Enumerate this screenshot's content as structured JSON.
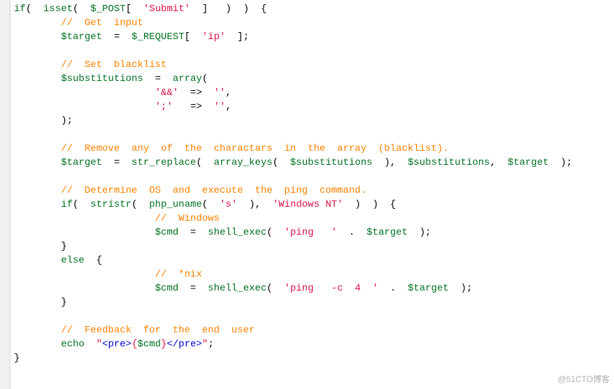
{
  "lines": [
    {
      "t": "l1",
      "segs": [
        {
          "cls": "kw",
          "txt": "if"
        },
        {
          "cls": "punc",
          "txt": "(  "
        },
        {
          "cls": "kw",
          "txt": "isset"
        },
        {
          "cls": "punc",
          "txt": "(  "
        },
        {
          "cls": "var",
          "txt": "$_POST"
        },
        {
          "cls": "punc",
          "txt": "[  "
        },
        {
          "cls": "str",
          "txt": "'Submit'"
        },
        {
          "cls": "punc",
          "txt": "  ]   )  )  {"
        }
      ]
    },
    {
      "t": "l2",
      "indent": 1,
      "segs": [
        {
          "cls": "cmt",
          "txt": "//  Get  input"
        }
      ]
    },
    {
      "t": "l3",
      "indent": 1,
      "segs": [
        {
          "cls": "var",
          "txt": "$target"
        },
        {
          "cls": "punc",
          "txt": "  =  "
        },
        {
          "cls": "var",
          "txt": "$_REQUEST"
        },
        {
          "cls": "punc",
          "txt": "[  "
        },
        {
          "cls": "str",
          "txt": "'ip'"
        },
        {
          "cls": "punc",
          "txt": "  ];"
        }
      ]
    },
    {
      "t": "blank1",
      "segs": []
    },
    {
      "t": "l4",
      "indent": 1,
      "segs": [
        {
          "cls": "cmt",
          "txt": "//  Set  blacklist"
        }
      ]
    },
    {
      "t": "l5",
      "indent": 1,
      "segs": [
        {
          "cls": "var",
          "txt": "$substitutions"
        },
        {
          "cls": "punc",
          "txt": "  =  "
        },
        {
          "cls": "kw",
          "txt": "array"
        },
        {
          "cls": "punc",
          "txt": "("
        }
      ]
    },
    {
      "t": "l6",
      "indent": 3,
      "segs": [
        {
          "cls": "str",
          "txt": "'&&'"
        },
        {
          "cls": "punc",
          "txt": "  =>  "
        },
        {
          "cls": "str",
          "txt": "''"
        },
        {
          "cls": "punc",
          "txt": ","
        }
      ]
    },
    {
      "t": "l7",
      "indent": 3,
      "segs": [
        {
          "cls": "str",
          "txt": "';'"
        },
        {
          "cls": "punc",
          "txt": "   =>  "
        },
        {
          "cls": "str",
          "txt": "''"
        },
        {
          "cls": "punc",
          "txt": ","
        }
      ]
    },
    {
      "t": "l8",
      "indent": 1,
      "segs": [
        {
          "cls": "punc",
          "txt": ");"
        }
      ]
    },
    {
      "t": "blank2",
      "segs": []
    },
    {
      "t": "l9",
      "indent": 1,
      "segs": [
        {
          "cls": "cmt",
          "txt": "//  Remove  any  of  the  charactars  in  the  array  (blacklist)."
        }
      ]
    },
    {
      "t": "l10",
      "indent": 1,
      "segs": [
        {
          "cls": "var",
          "txt": "$target"
        },
        {
          "cls": "punc",
          "txt": "  =  "
        },
        {
          "cls": "kw",
          "txt": "str_replace"
        },
        {
          "cls": "punc",
          "txt": "(  "
        },
        {
          "cls": "kw",
          "txt": "array_keys"
        },
        {
          "cls": "punc",
          "txt": "(  "
        },
        {
          "cls": "var",
          "txt": "$substitutions"
        },
        {
          "cls": "punc",
          "txt": "  ),  "
        },
        {
          "cls": "var",
          "txt": "$substitutions"
        },
        {
          "cls": "punc",
          "txt": ",  "
        },
        {
          "cls": "var",
          "txt": "$target"
        },
        {
          "cls": "punc",
          "txt": "  );"
        }
      ]
    },
    {
      "t": "blank3",
      "segs": []
    },
    {
      "t": "l11",
      "indent": 1,
      "segs": [
        {
          "cls": "cmt",
          "txt": "//  Determine  OS  and  execute  the  ping  command."
        }
      ]
    },
    {
      "t": "l12",
      "indent": 1,
      "segs": [
        {
          "cls": "kw",
          "txt": "if"
        },
        {
          "cls": "punc",
          "txt": "(  "
        },
        {
          "cls": "kw",
          "txt": "stristr"
        },
        {
          "cls": "punc",
          "txt": "(  "
        },
        {
          "cls": "kw",
          "txt": "php_uname"
        },
        {
          "cls": "punc",
          "txt": "(  "
        },
        {
          "cls": "str",
          "txt": "'s'"
        },
        {
          "cls": "punc",
          "txt": "  ),  "
        },
        {
          "cls": "str",
          "txt": "'Windows NT'"
        },
        {
          "cls": "punc",
          "txt": "  )  )  {"
        }
      ]
    },
    {
      "t": "l13",
      "indent": 3,
      "segs": [
        {
          "cls": "cmt",
          "txt": "//  Windows"
        }
      ]
    },
    {
      "t": "l14",
      "indent": 3,
      "segs": [
        {
          "cls": "var",
          "txt": "$cmd"
        },
        {
          "cls": "punc",
          "txt": "  =  "
        },
        {
          "cls": "kw",
          "txt": "shell_exec"
        },
        {
          "cls": "punc",
          "txt": "(  "
        },
        {
          "cls": "str",
          "txt": "'ping   '"
        },
        {
          "cls": "punc",
          "txt": "  .  "
        },
        {
          "cls": "var",
          "txt": "$target"
        },
        {
          "cls": "punc",
          "txt": "  );"
        }
      ]
    },
    {
      "t": "l15",
      "indent": 1,
      "segs": [
        {
          "cls": "punc",
          "txt": "}"
        }
      ]
    },
    {
      "t": "l16",
      "indent": 1,
      "segs": [
        {
          "cls": "kw",
          "txt": "else"
        },
        {
          "cls": "punc",
          "txt": "  {"
        }
      ]
    },
    {
      "t": "l17",
      "indent": 3,
      "segs": [
        {
          "cls": "cmt",
          "txt": "//  *nix"
        }
      ]
    },
    {
      "t": "l18",
      "indent": 3,
      "segs": [
        {
          "cls": "var",
          "txt": "$cmd"
        },
        {
          "cls": "punc",
          "txt": "  =  "
        },
        {
          "cls": "kw",
          "txt": "shell_exec"
        },
        {
          "cls": "punc",
          "txt": "(  "
        },
        {
          "cls": "str",
          "txt": "'ping   -c  4  '"
        },
        {
          "cls": "punc",
          "txt": "  .  "
        },
        {
          "cls": "var",
          "txt": "$target"
        },
        {
          "cls": "punc",
          "txt": "  );"
        }
      ]
    },
    {
      "t": "l19",
      "indent": 1,
      "segs": [
        {
          "cls": "punc",
          "txt": "}"
        }
      ]
    },
    {
      "t": "blank4",
      "segs": []
    },
    {
      "t": "l20",
      "indent": 1,
      "segs": [
        {
          "cls": "cmt",
          "txt": "//  Feedback  for  the  end  user"
        }
      ]
    },
    {
      "t": "l21",
      "indent": 1,
      "segs": [
        {
          "cls": "kw",
          "txt": "echo"
        },
        {
          "cls": "punc",
          "txt": "  "
        },
        {
          "cls": "str",
          "txt": "\""
        },
        {
          "cls": "strblue",
          "txt": "<pre>"
        },
        {
          "cls": "str",
          "txt": "{"
        },
        {
          "cls": "var",
          "txt": "$cmd"
        },
        {
          "cls": "str",
          "txt": "}"
        },
        {
          "cls": "strblue",
          "txt": "</pre>"
        },
        {
          "cls": "str",
          "txt": "\""
        },
        {
          "cls": "punc",
          "txt": ";"
        }
      ]
    },
    {
      "t": "l22",
      "segs": [
        {
          "cls": "punc",
          "txt": "}"
        }
      ]
    }
  ],
  "watermark": "@51CTO博客"
}
